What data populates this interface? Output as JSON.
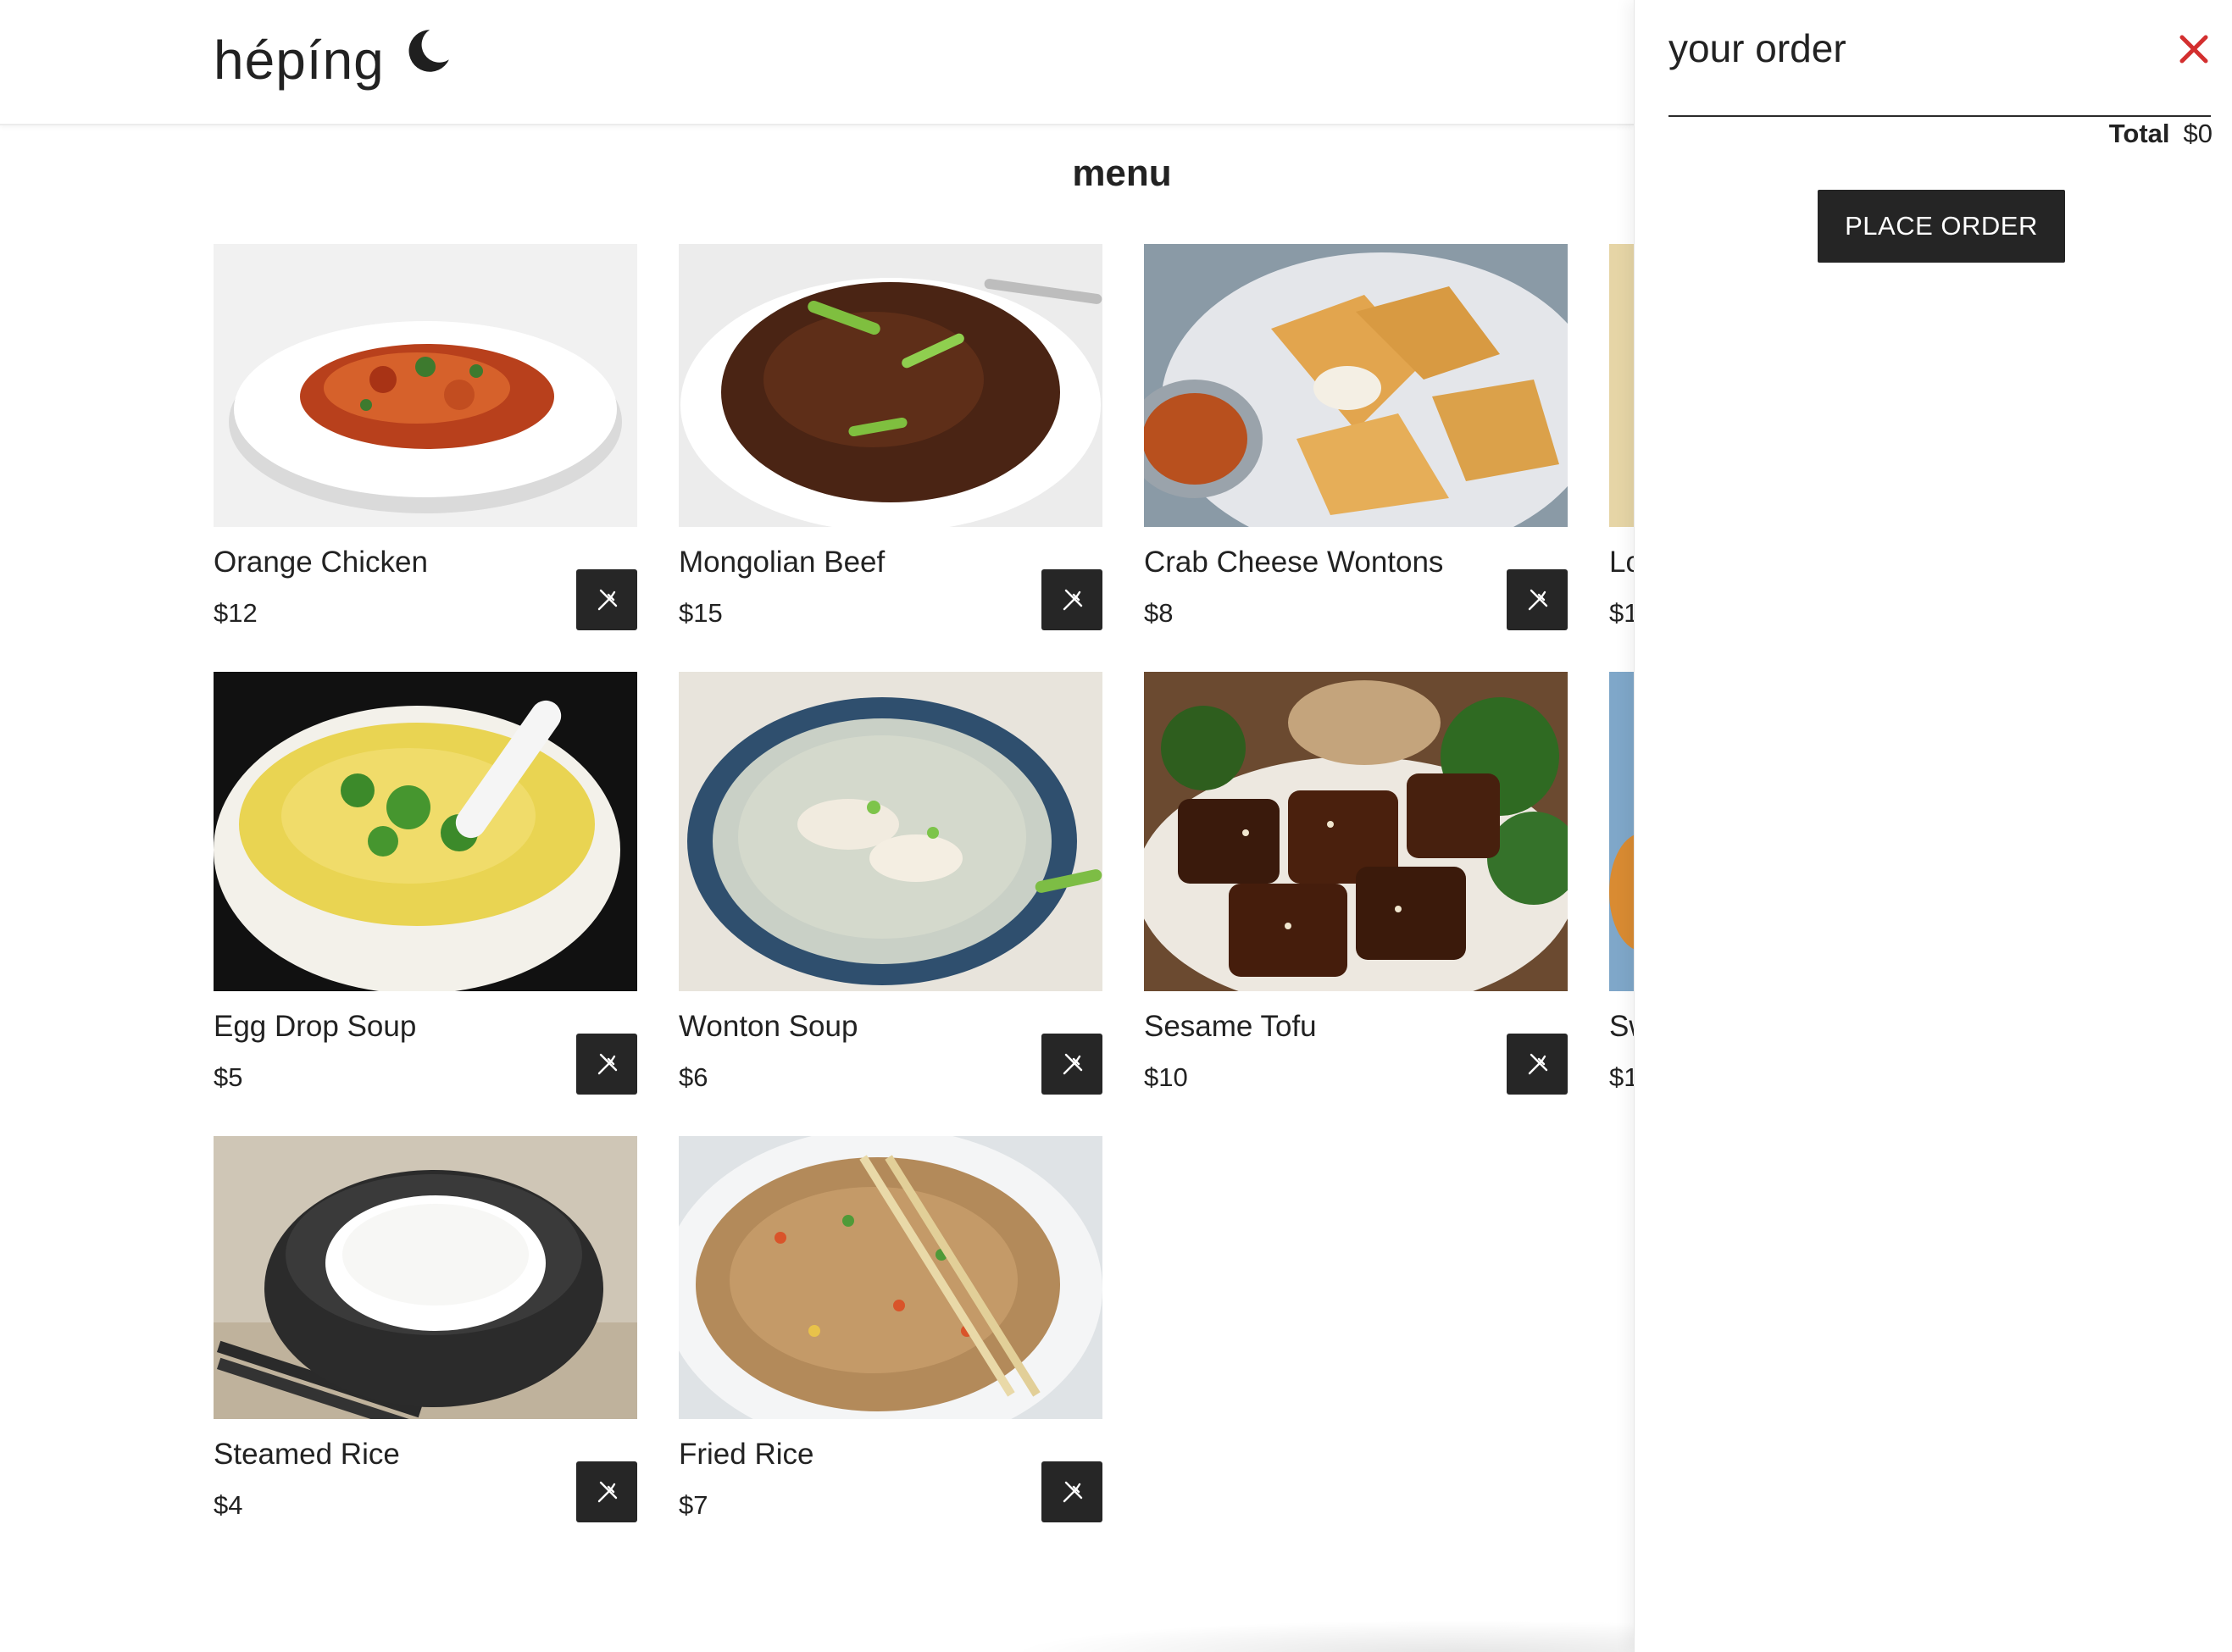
{
  "brand": {
    "name": "hépíng",
    "icon": "moon-icon"
  },
  "menu": {
    "title": "menu",
    "items": [
      {
        "name": "Orange Chicken",
        "price": "$12",
        "image": "orange-chicken-photo"
      },
      {
        "name": "Mongolian Beef",
        "price": "$15",
        "image": "mongolian-beef-photo"
      },
      {
        "name": "Crab Cheese Wontons",
        "price": "$8",
        "image": "crab-wontons-photo"
      },
      {
        "name": "Lo",
        "price": "$1",
        "image": "lo-mein-photo-partial"
      },
      {
        "name": "Egg Drop Soup",
        "price": "$5",
        "image": "egg-drop-soup-photo"
      },
      {
        "name": "Wonton Soup",
        "price": "$6",
        "image": "wonton-soup-photo"
      },
      {
        "name": "Sesame Tofu",
        "price": "$10",
        "image": "sesame-tofu-photo"
      },
      {
        "name": "Sw",
        "price": "$1",
        "image": "sweet-sour-photo-partial"
      },
      {
        "name": "Steamed Rice",
        "price": "$4",
        "image": "steamed-rice-photo"
      },
      {
        "name": "Fried Rice",
        "price": "$7",
        "image": "fried-rice-photo"
      }
    ],
    "add_icon": "fork-knife-icon"
  },
  "cart": {
    "title": "your order",
    "total_label": "Total",
    "total_value": "$0",
    "place_order_label": "PLACE ORDER",
    "close_icon": "close-icon"
  },
  "colors": {
    "accent_close": "#d32f2f",
    "button_dark": "#252525",
    "text": "#222222"
  }
}
